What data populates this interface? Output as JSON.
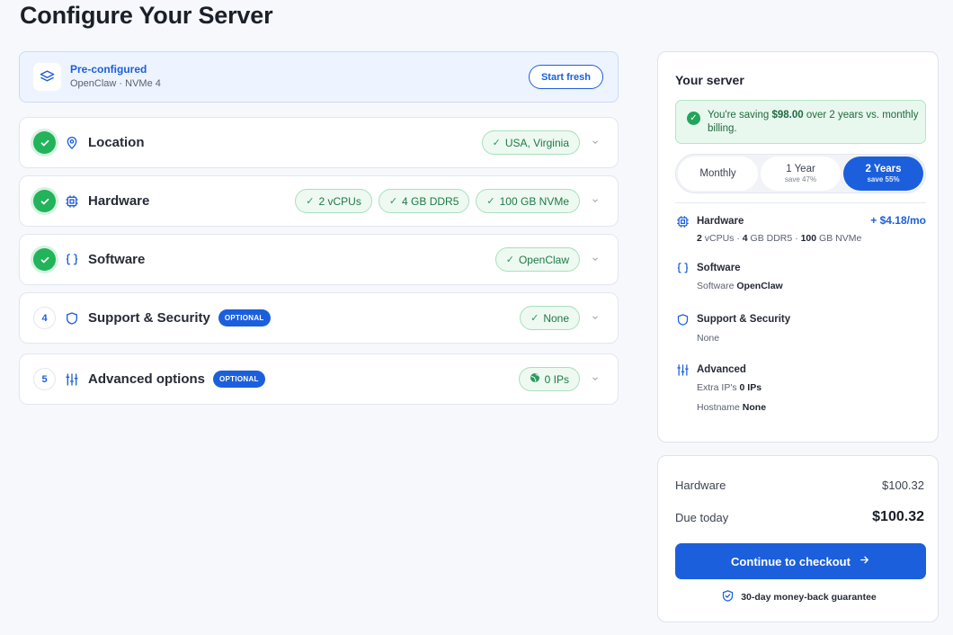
{
  "page": {
    "title": "Configure Your Server"
  },
  "preconfigured": {
    "title": "Pre-configured",
    "subtitle": "OpenClaw · NVMe 4",
    "button": "Start fresh"
  },
  "sections": [
    {
      "label": "Location",
      "status": "done",
      "chips": [
        "USA, Virginia"
      ]
    },
    {
      "label": "Hardware",
      "status": "done",
      "chips": [
        "2 vCPUs",
        "4 GB DDR5",
        "100 GB NVMe"
      ]
    },
    {
      "label": "Software",
      "status": "done",
      "chips": [
        "OpenClaw"
      ]
    },
    {
      "label": "Support & Security",
      "status": "4",
      "badge": "OPTIONAL",
      "chips": [
        "None"
      ]
    },
    {
      "label": "Advanced options",
      "status": "5",
      "badge": "OPTIONAL",
      "chips": [
        "0 IPs"
      ]
    }
  ],
  "summary": {
    "title": "Your server",
    "saving": {
      "prefix": "You're saving ",
      "amount": "$98.00",
      "suffix": " over 2 years vs. monthly billing."
    },
    "billing_tabs": [
      {
        "label": "Monthly",
        "sub": ""
      },
      {
        "label": "1 Year",
        "sub": "save 47%"
      },
      {
        "label": "2 Years",
        "sub": "save 55%"
      }
    ],
    "billing_selected": "2 Years",
    "hardware": {
      "title": "Hardware",
      "price": "+ $4.18/mo",
      "cpu_n": "2",
      "cpu_u": "vCPUs",
      "ram_n": "4",
      "ram_u": "GB DDR5",
      "disk_n": "100",
      "disk_u": "GB NVMe",
      "sep": "·"
    },
    "software": {
      "title": "Software",
      "key": "Software",
      "value": "OpenClaw"
    },
    "support": {
      "title": "Support & Security",
      "value": "None"
    },
    "advanced": {
      "title": "Advanced",
      "ips_key": "Extra IP's",
      "ips_value": "0 IPs",
      "host_key": "Hostname",
      "host_value": "None"
    }
  },
  "checkout": {
    "hardware_label": "Hardware",
    "hardware_value": "$100.32",
    "due_label": "Due today",
    "due_value": "$100.32",
    "button": "Continue to checkout",
    "guarantee": "30-day money-back guarantee"
  },
  "colors": {
    "primary": "#1b5fdc",
    "success": "#22b35b",
    "chip_bg": "#edf9f1",
    "chip_text": "#1f7a46"
  }
}
